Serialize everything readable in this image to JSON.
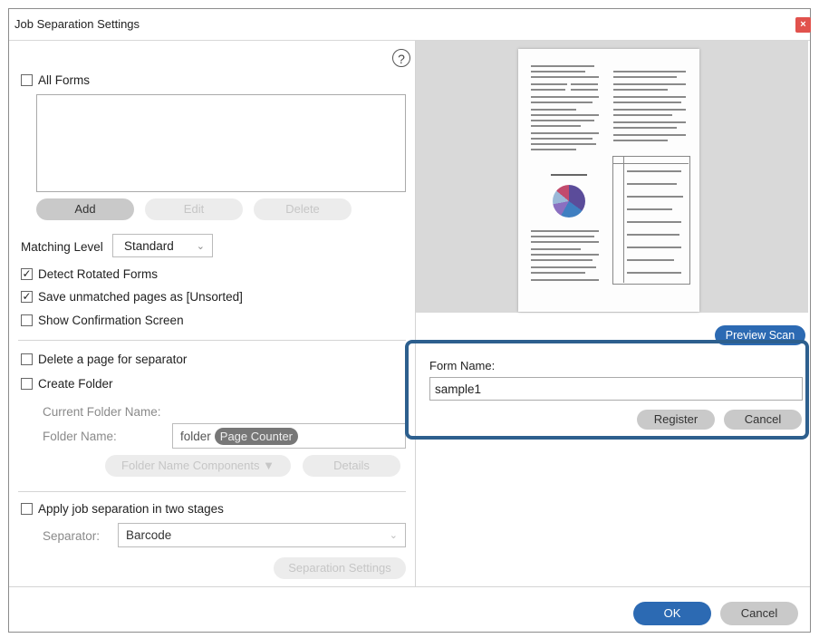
{
  "window": {
    "title": "Job Separation Settings",
    "close_glyph": "×"
  },
  "help": {
    "glyph": "?"
  },
  "forms": {
    "all_forms_label": "All Forms",
    "add_label": "Add",
    "edit_label": "Edit",
    "delete_label": "Delete"
  },
  "matching": {
    "label": "Matching Level",
    "value": "Standard",
    "arrow": "⌄"
  },
  "options": {
    "detect_rotated": "Detect Rotated Forms",
    "save_unmatched": "Save unmatched pages as [Unsorted]",
    "show_confirmation": "Show Confirmation Screen",
    "check_glyph": "✓"
  },
  "separator_options": {
    "delete_page": "Delete a page for separator",
    "create_folder": "Create Folder",
    "current_folder_name": "Current Folder Name:",
    "folder_name_label": "Folder Name:",
    "folder_name_prefix": "folder",
    "folder_token": "Page Counter",
    "components_label": "Folder Name Components ▼",
    "details_label": "Details"
  },
  "two_stage": {
    "label": "Apply job separation in two stages",
    "separator_label": "Separator:",
    "separator_value": "Barcode",
    "arrow": "⌄",
    "settings_label": "Separation Settings"
  },
  "preview": {
    "button_label": "Preview Scan"
  },
  "form_name": {
    "label": "Form Name:",
    "value": "sample1",
    "register_label": "Register",
    "cancel_label": "Cancel"
  },
  "footer": {
    "ok_label": "OK",
    "cancel_label": "Cancel"
  },
  "colors": {
    "accent": "#2c6ab3",
    "highlight_border": "#2d5f8e",
    "close": "#e1524d"
  }
}
